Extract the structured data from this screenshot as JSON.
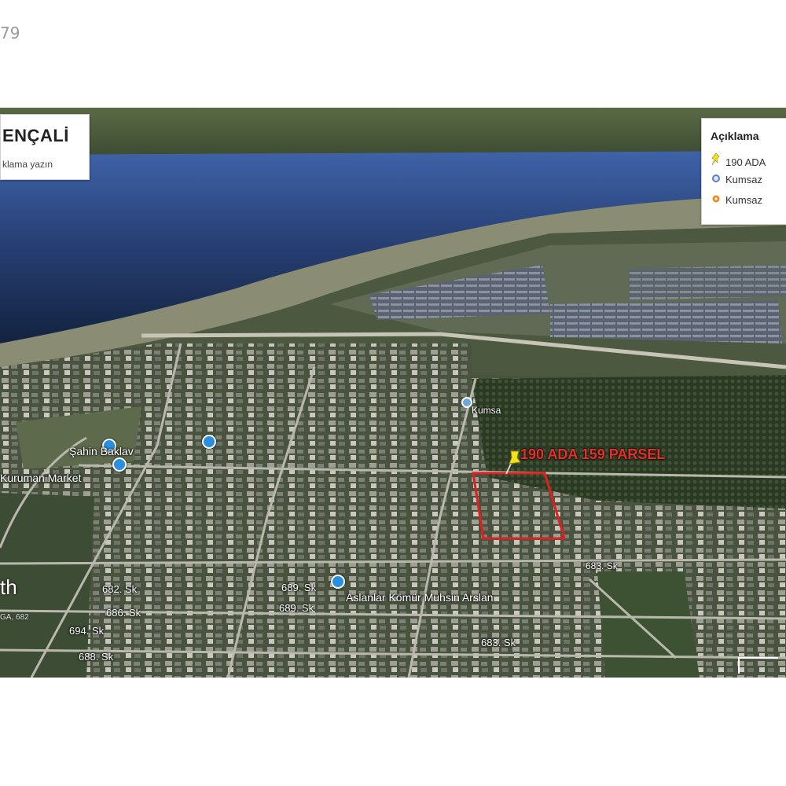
{
  "listing_id_fragment": "79",
  "map_title": {
    "place": "ENÇALİ",
    "description_placeholder": "klama yazın"
  },
  "legend": {
    "title": "Açıklama",
    "items": [
      {
        "label": "190 ADA",
        "icon": "yellow-pushpin-icon",
        "color": "#f2e21a"
      },
      {
        "label": "Kumsaz",
        "icon": "blue-dot-icon",
        "color": "#5b7fcf"
      },
      {
        "label": "Kumsaz",
        "icon": "orange-dot-icon",
        "color": "#f08a24"
      }
    ]
  },
  "parcel_label": "190 ADA 159 PARSEL",
  "parcel_outline_color": "#e02020",
  "place_labels": {
    "label_1": "Şahin Baklav",
    "label_2": "Kuruman Market",
    "label_3": "Aslanlar Kömür Muhsin Arslan",
    "label_4": "Kumsa"
  },
  "street_labels": {
    "s1": "682. Sk",
    "s2": "694. Sk",
    "s3": "688. Sk",
    "s4": "686. Sk",
    "s5": "689. Sk",
    "s6": "689. Sk",
    "s7": "683. Sk",
    "s8": "683. Sk"
  },
  "attribution": {
    "brand": "th",
    "sub": "GA, 682"
  },
  "colors": {
    "sea": "#2b4a86",
    "hills": "#4a5b3a",
    "town": "#5b6652",
    "road": "#b9b9b0"
  }
}
